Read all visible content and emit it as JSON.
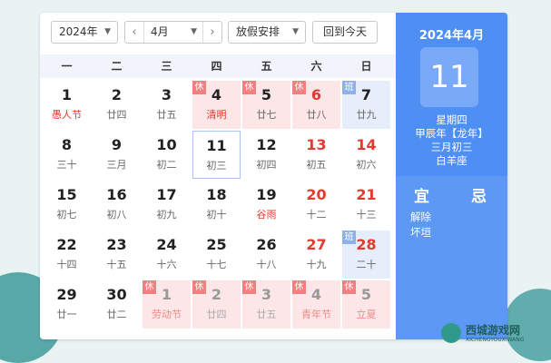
{
  "toolbar": {
    "year": "2024年",
    "month": "4月",
    "holiday_select": "放假安排",
    "today_button": "回到今天"
  },
  "weekdays": [
    "一",
    "二",
    "三",
    "四",
    "五",
    "六",
    "日"
  ],
  "tags": {
    "rest": "休",
    "work": "班"
  },
  "days": [
    {
      "n": "1",
      "s": "愚人节",
      "fest": true
    },
    {
      "n": "2",
      "s": "廿四"
    },
    {
      "n": "3",
      "s": "廿五"
    },
    {
      "n": "4",
      "s": "清明",
      "fest": true,
      "tag": "rest"
    },
    {
      "n": "5",
      "s": "廿七",
      "tag": "rest"
    },
    {
      "n": "6",
      "s": "廿八",
      "red": true,
      "tag": "rest"
    },
    {
      "n": "7",
      "s": "廿九",
      "tag": "work"
    },
    {
      "n": "8",
      "s": "三十"
    },
    {
      "n": "9",
      "s": "三月"
    },
    {
      "n": "10",
      "s": "初二"
    },
    {
      "n": "11",
      "s": "初三",
      "today": true
    },
    {
      "n": "12",
      "s": "初四"
    },
    {
      "n": "13",
      "s": "初五",
      "red": true
    },
    {
      "n": "14",
      "s": "初六",
      "red": true
    },
    {
      "n": "15",
      "s": "初七"
    },
    {
      "n": "16",
      "s": "初八"
    },
    {
      "n": "17",
      "s": "初九"
    },
    {
      "n": "18",
      "s": "初十"
    },
    {
      "n": "19",
      "s": "谷雨",
      "fest": true
    },
    {
      "n": "20",
      "s": "十二",
      "red": true
    },
    {
      "n": "21",
      "s": "十三",
      "red": true
    },
    {
      "n": "22",
      "s": "十四"
    },
    {
      "n": "23",
      "s": "十五"
    },
    {
      "n": "24",
      "s": "十六"
    },
    {
      "n": "25",
      "s": "十七"
    },
    {
      "n": "26",
      "s": "十八"
    },
    {
      "n": "27",
      "s": "十九",
      "red": true
    },
    {
      "n": "28",
      "s": "二十",
      "red": true,
      "tag": "work"
    },
    {
      "n": "29",
      "s": "廿一"
    },
    {
      "n": "30",
      "s": "廿二"
    },
    {
      "n": "1",
      "s": "劳动节",
      "fest": true,
      "tag": "rest",
      "dim": true
    },
    {
      "n": "2",
      "s": "廿四",
      "tag": "rest",
      "dim": true
    },
    {
      "n": "3",
      "s": "廿五",
      "tag": "rest",
      "dim": true
    },
    {
      "n": "4",
      "s": "青年节",
      "fest": true,
      "tag": "rest",
      "dim": true
    },
    {
      "n": "5",
      "s": "立夏",
      "fest": true,
      "tag": "rest",
      "dim": true
    }
  ],
  "side": {
    "title": "2024年4月",
    "day": "11",
    "weekday": "星期四",
    "ganzhi": "甲辰年【龙年】",
    "lunar": "三月初三",
    "constellation": "白羊座",
    "yi_label": "宜",
    "ji_label": "忌",
    "yi_items": [
      "解除",
      "坏垣"
    ]
  },
  "watermark": {
    "name": "西城游戏网",
    "url": "XICHENGYOUXIWANG"
  },
  "colors": {
    "accent": "#4d8ff2",
    "rest": "#fde6e8",
    "work": "#e6eefb",
    "festival": "#e23b2e"
  }
}
